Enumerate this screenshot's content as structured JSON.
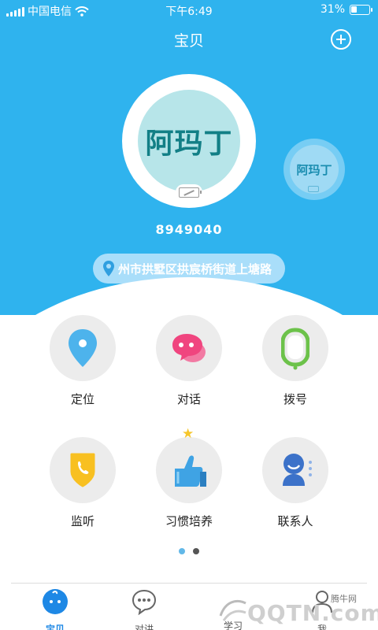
{
  "status_bar": {
    "carrier": "中国电信",
    "time": "下午6:49",
    "battery_percent": "31%",
    "battery_level": 0.31
  },
  "navbar": {
    "title": "宝贝",
    "add_icon": "plus-circle-icon"
  },
  "baby": {
    "avatar_text": "阿玛丁",
    "device_id": "8949040",
    "location": "州市拱墅区拱宸桥街道上塘路"
  },
  "functions": [
    {
      "label": "定位",
      "icon": "location-pin-icon",
      "color": "#4db3ec"
    },
    {
      "label": "对话",
      "icon": "chat-bubbles-icon",
      "color": "#f0457f"
    },
    {
      "label": "拨号",
      "icon": "watch-dial-icon",
      "color": "#6cc24a"
    },
    {
      "label": "监听",
      "icon": "phone-shield-icon",
      "color": "#f8c021"
    },
    {
      "label": "习惯培养",
      "icon": "thumbs-up-icon",
      "color": "#3fa3e4"
    },
    {
      "label": "联系人",
      "icon": "contact-person-icon",
      "color": "#3c72c9"
    }
  ],
  "page_dots": {
    "count": 2,
    "active": 0,
    "active_color": "#62b8e8",
    "inactive_color": "#555555"
  },
  "tabbar": {
    "items": [
      {
        "label": "宝贝",
        "icon": "baby-face-icon",
        "active": true
      },
      {
        "label": "对讲",
        "icon": "talk-bubble-icon",
        "active": false
      },
      {
        "label": "学习",
        "icon": "study-icon",
        "active": false
      },
      {
        "label": "我",
        "icon": "person-icon",
        "active": false
      }
    ],
    "active_color": "#1e88e5"
  },
  "watermark": {
    "logo": "QQTN.com",
    "caption": "腾牛网"
  },
  "colors": {
    "header_blue": "#2fb3ee",
    "pill": "#a9defa"
  }
}
